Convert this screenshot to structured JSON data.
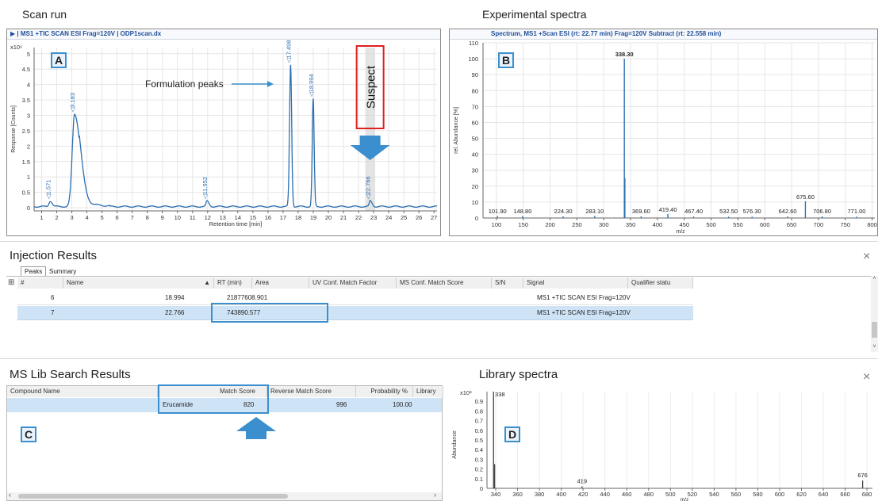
{
  "panels": {
    "scan_title": "Scan run",
    "exp_title": "Experimental spectra",
    "injection_title": "Injection Results",
    "mslib_title": "MS Lib Search Results",
    "library_title": "Library spectra",
    "letters": {
      "a": "A",
      "b": "B",
      "c": "C",
      "d": "D"
    }
  },
  "chart_a": {
    "header": "| MS1 +TIC SCAN ESI Frag=120V | ODP1scan.dx",
    "exponent": "x10⁶",
    "ylabel": "Response [Counts]",
    "xlabel": "Retention time [min]",
    "annotation": "Formulation peaks",
    "suspect": "Suspect"
  },
  "chart_b": {
    "header": "Spectrum, MS1 +Scan ESI (rt: 22.77 min) Frag=120V Subtract (rt: 22.558 min)",
    "ylabel": "rel. Abundance [%]",
    "xlabel": "m/z"
  },
  "chart_d": {
    "exponent": "x10³",
    "ylabel": "Abundance",
    "xlabel": "m/z"
  },
  "chart_data": [
    {
      "type": "line",
      "title": "Scan run",
      "xlabel": "Retention time [min]",
      "ylabel": "Response [Counts]",
      "xlim": [
        0.5,
        27.2
      ],
      "ylim": [
        -0.1,
        5.2
      ],
      "y_scale": "x10^6",
      "x_ticks": [
        1,
        2,
        3,
        4,
        5,
        6,
        7,
        8,
        9,
        10,
        11,
        12,
        13,
        14,
        15,
        16,
        17,
        18,
        19,
        20,
        21,
        22,
        23,
        24,
        25,
        26,
        27
      ],
      "y_ticks": [
        0,
        0.5,
        1,
        1.5,
        2,
        2.5,
        3,
        3.5,
        4,
        4.5,
        5
      ],
      "peaks": [
        {
          "label": "1.571",
          "x": 1.571,
          "y": 0.18
        },
        {
          "label": "3.183",
          "x": 3.183,
          "y": 3.0
        },
        {
          "label": "11.952",
          "x": 11.952,
          "y": 0.18
        },
        {
          "label": "17.498",
          "x": 17.498,
          "y": 4.6
        },
        {
          "label": "18.994",
          "x": 18.994,
          "y": 3.5
        },
        {
          "label": "22.766",
          "x": 22.766,
          "y": 0.18
        }
      ]
    },
    {
      "type": "bar",
      "title": "Experimental spectra",
      "xlabel": "m/z",
      "ylabel": "rel. Abundance [%]",
      "xlim": [
        75,
        805
      ],
      "ylim": [
        0,
        110
      ],
      "x_ticks": [
        100,
        150,
        200,
        250,
        300,
        350,
        400,
        450,
        500,
        550,
        600,
        650,
        700,
        750,
        800
      ],
      "y_ticks": [
        0,
        10,
        20,
        30,
        40,
        50,
        60,
        70,
        80,
        90,
        100,
        110
      ],
      "peaks": [
        {
          "label": "101.90",
          "x": 101.9,
          "y": 1.2
        },
        {
          "label": "148.80",
          "x": 148.8,
          "y": 1.2
        },
        {
          "label": "224.30",
          "x": 224.3,
          "y": 1.0
        },
        {
          "label": "283.10",
          "x": 283.1,
          "y": 1.3
        },
        {
          "label": "338.30",
          "x": 338.3,
          "y": 100
        },
        {
          "label": "",
          "x": 339.3,
          "y": 25
        },
        {
          "label": "369.60",
          "x": 369.6,
          "y": 1.0
        },
        {
          "label": "419.40",
          "x": 419.4,
          "y": 2.5
        },
        {
          "label": "467.40",
          "x": 467.4,
          "y": 0.9
        },
        {
          "label": "532.50",
          "x": 532.5,
          "y": 0.8
        },
        {
          "label": "576.30",
          "x": 576.3,
          "y": 0.8
        },
        {
          "label": "642.60",
          "x": 642.6,
          "y": 1.0
        },
        {
          "label": "675.60",
          "x": 675.6,
          "y": 10.5
        },
        {
          "label": "706.80",
          "x": 706.8,
          "y": 1.0
        },
        {
          "label": "771.00",
          "x": 771.0,
          "y": 0.8
        }
      ]
    },
    {
      "type": "bar",
      "title": "Library spectra",
      "xlabel": "m/z",
      "ylabel": "Abundance",
      "xlim": [
        332,
        685
      ],
      "ylim": [
        0,
        1.0
      ],
      "y_scale": "x10^3",
      "x_ticks": [
        340,
        360,
        380,
        400,
        420,
        440,
        460,
        480,
        500,
        520,
        540,
        560,
        580,
        600,
        620,
        640,
        660,
        680
      ],
      "y_ticks": [
        0,
        0.1,
        0.2,
        0.3,
        0.4,
        0.5,
        0.6,
        0.7,
        0.8,
        0.9
      ],
      "peaks": [
        {
          "label": "338",
          "x": 338,
          "y": 1.0
        },
        {
          "label": "",
          "x": 339,
          "y": 0.25
        },
        {
          "label": "419",
          "x": 419,
          "y": 0.02
        },
        {
          "label": "676",
          "x": 676,
          "y": 0.08
        }
      ]
    }
  ],
  "injection": {
    "tabs": [
      "Peaks",
      "Summary"
    ],
    "columns": [
      "#",
      "Name",
      "RT (min)",
      "Area",
      "UV Conf. Match Factor",
      "MS Conf. Match Score",
      "S/N",
      "Signal",
      "Qualifier statu"
    ],
    "rows": [
      {
        "num": "6",
        "name": "",
        "rt": "18.994",
        "area": "21877608.901",
        "uv": "",
        "ms": "",
        "sn": "",
        "signal": "MS1 +TIC SCAN ESI Frag=120V",
        "qual": ""
      },
      {
        "num": "7",
        "name": "",
        "rt": "22.766",
        "area": "743890.577",
        "uv": "",
        "ms": "",
        "sn": "",
        "signal": "MS1 +TIC SCAN ESI Frag=120V",
        "qual": ""
      }
    ]
  },
  "mslib": {
    "columns": [
      "Compound Name",
      "Match Score",
      "Reverse Match Score",
      "Probability %",
      "Library"
    ],
    "row": {
      "compound": "",
      "name2": "Erucamide",
      "match": "820",
      "reverse": "996",
      "prob": "100.00"
    }
  },
  "colors": {
    "accent": "#3c8fce",
    "trace": "#2c6fb0",
    "suspect": "#e02020",
    "row_selected": "#cfe3f6"
  }
}
